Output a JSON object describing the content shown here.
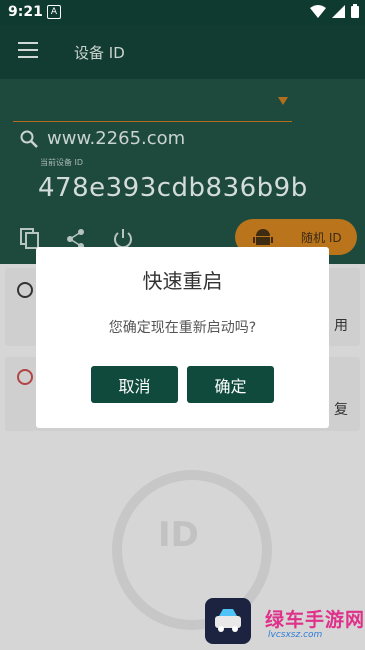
{
  "status": {
    "time": "9:21"
  },
  "toolbar": {
    "title": "设备 ID"
  },
  "main": {
    "domain": "www.2265.com",
    "current_label": "当前设备 ID",
    "device_id": "478e393cdb836b9b",
    "random_button": "随机 ID"
  },
  "cards": [
    {
      "trailing": "用"
    },
    {
      "trailing": "复"
    }
  ],
  "dialog": {
    "title": "快速重启",
    "message": "您确定现在重新启动吗?",
    "cancel": "取消",
    "confirm": "确定"
  },
  "watermark": {
    "text": "ID"
  },
  "brand": {
    "name": "绿车手游网",
    "url": "lvcsxsz.com"
  },
  "colors": {
    "dark_green": "#123b31",
    "accent_orange": "#b9741c",
    "button_green": "#0f4a3c"
  }
}
